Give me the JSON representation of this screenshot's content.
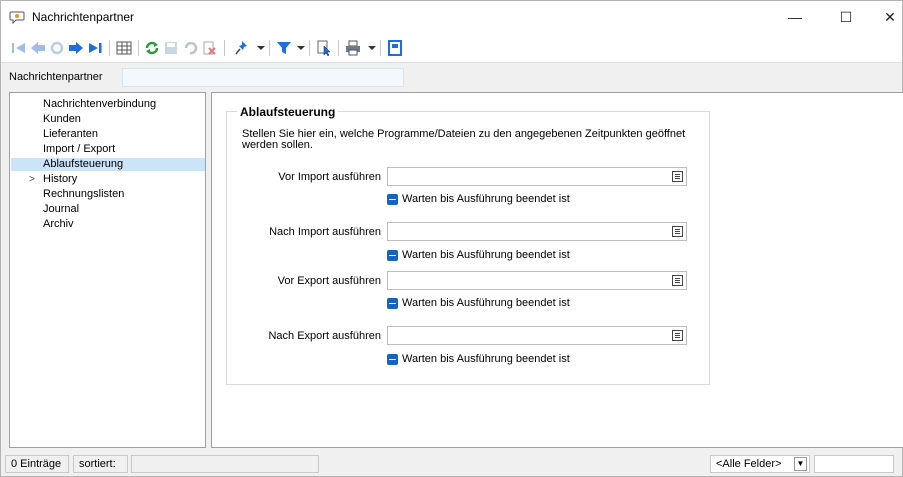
{
  "window": {
    "title": "Nachrichtenpartner",
    "minimize": "—",
    "maximize": "☐",
    "close": "✕"
  },
  "toolbar": {
    "icons": [
      "first-icon",
      "previous-icon",
      "refresh-disabled-icon",
      "next-icon",
      "last-icon",
      "table-icon",
      "reload-icon",
      "save-icon",
      "undo-icon",
      "delete-icon",
      "pin-icon",
      "filter-icon",
      "document-pointer-icon",
      "print-icon",
      "form-icon"
    ]
  },
  "search": {
    "label": "Nachrichtenpartner",
    "value": ""
  },
  "nav": {
    "items": [
      {
        "label": "Nachrichtenverbindung"
      },
      {
        "label": "Kunden"
      },
      {
        "label": "Lieferanten"
      },
      {
        "label": "Import / Export"
      },
      {
        "label": "Ablaufsteuerung",
        "selected": true
      },
      {
        "label": "History",
        "expander": ">"
      },
      {
        "label": "Rechnungslisten"
      },
      {
        "label": "Journal"
      },
      {
        "label": "Archiv"
      }
    ]
  },
  "main": {
    "group_title": "Ablaufsteuerung",
    "description": "Stellen Sie hier ein, welche Programme/Dateien zu den angegebenen Zeitpunkten geöffnet werden sollen.",
    "fields": [
      {
        "label": "Vor Import ausführen",
        "value": "",
        "check_label": "Warten bis Ausführung beendet ist"
      },
      {
        "label": "Nach Import ausführen",
        "value": "",
        "check_label": "Warten bis Ausführung beendet ist"
      },
      {
        "label": "Vor Export ausführen",
        "value": "",
        "check_label": "Warten bis Ausführung beendet ist"
      },
      {
        "label": "Nach Export ausführen",
        "value": "",
        "check_label": "Warten bis Ausführung beendet ist"
      }
    ]
  },
  "status": {
    "count": "0 Einträge",
    "sorted": "sortiert:",
    "field_select": "<Alle Felder>"
  },
  "colors": {
    "selection": "#cce4f7",
    "checkbox": "#1565c0",
    "toolbar_blue": "#1e6fd9",
    "toolbar_green": "#2e9b3a"
  }
}
